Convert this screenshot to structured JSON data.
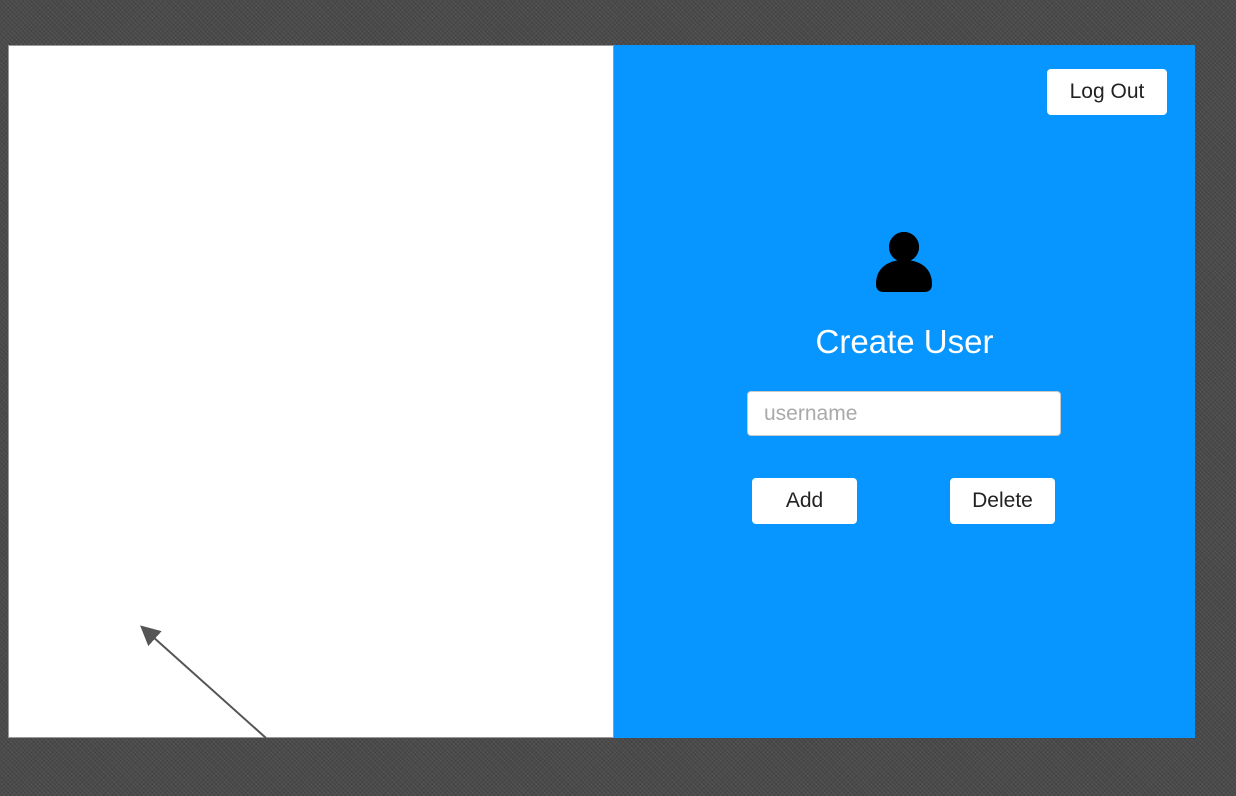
{
  "colors": {
    "panel_accent": "#0796ff",
    "background": "#4a4a4a",
    "button_bg": "#ffffff",
    "icon": "#000000"
  },
  "header": {
    "logout_label": "Log Out"
  },
  "form": {
    "icon": "user-icon",
    "title": "Create User",
    "username_value": "",
    "username_placeholder": "username",
    "add_label": "Add",
    "delete_label": "Delete"
  }
}
